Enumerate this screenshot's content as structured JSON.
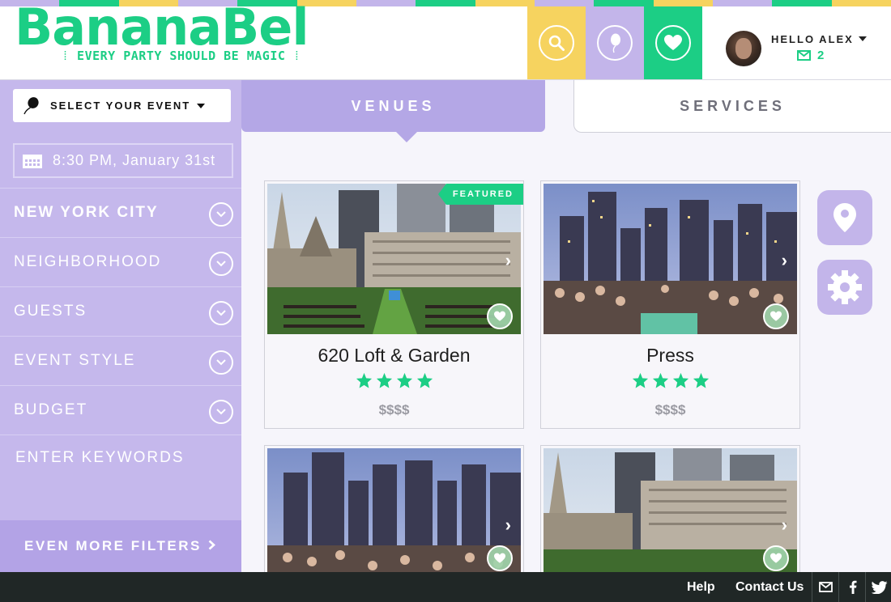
{
  "brand": {
    "name": "BananaBel",
    "tagline": "EVERY PARTY SHOULD BE MAGIC",
    "colors": {
      "green": "#1cce85",
      "purple": "#c3b5ea",
      "yellow": "#f6d35f"
    }
  },
  "header": {
    "icons": [
      "search-icon",
      "balloon-icon",
      "heart-icon"
    ],
    "user": {
      "greeting": "HELLO ALEX",
      "message_count": "2"
    }
  },
  "sidebar": {
    "select_event": "SELECT YOUR EVENT",
    "date": "8:30 PM, January 31st",
    "filters": [
      {
        "label": "NEW YORK CITY"
      },
      {
        "label": "NEIGHBORHOOD"
      },
      {
        "label": "GUESTS"
      },
      {
        "label": "EVENT STYLE"
      },
      {
        "label": "BUDGET"
      }
    ],
    "keywords_placeholder": "ENTER KEYWORDS",
    "more_filters": "EVEN MORE FILTERS"
  },
  "tabs": {
    "venues": "VENUES",
    "services": "SERVICES",
    "active": "VENUES"
  },
  "venues": [
    {
      "name": "620 Loft & Garden",
      "rating": 4,
      "price": "$$$$",
      "badge": "FEATURED"
    },
    {
      "name": "Press",
      "rating": 4,
      "price": "$$$$"
    },
    {
      "name": "",
      "rating": 0,
      "price": ""
    },
    {
      "name": "",
      "rating": 0,
      "price": ""
    }
  ],
  "floating": [
    "map-pin-icon",
    "settings-gear-icon"
  ],
  "footer": {
    "help": "Help",
    "contact": "Contact Us",
    "icons": [
      "mail-icon",
      "facebook-icon",
      "twitter-icon"
    ]
  }
}
